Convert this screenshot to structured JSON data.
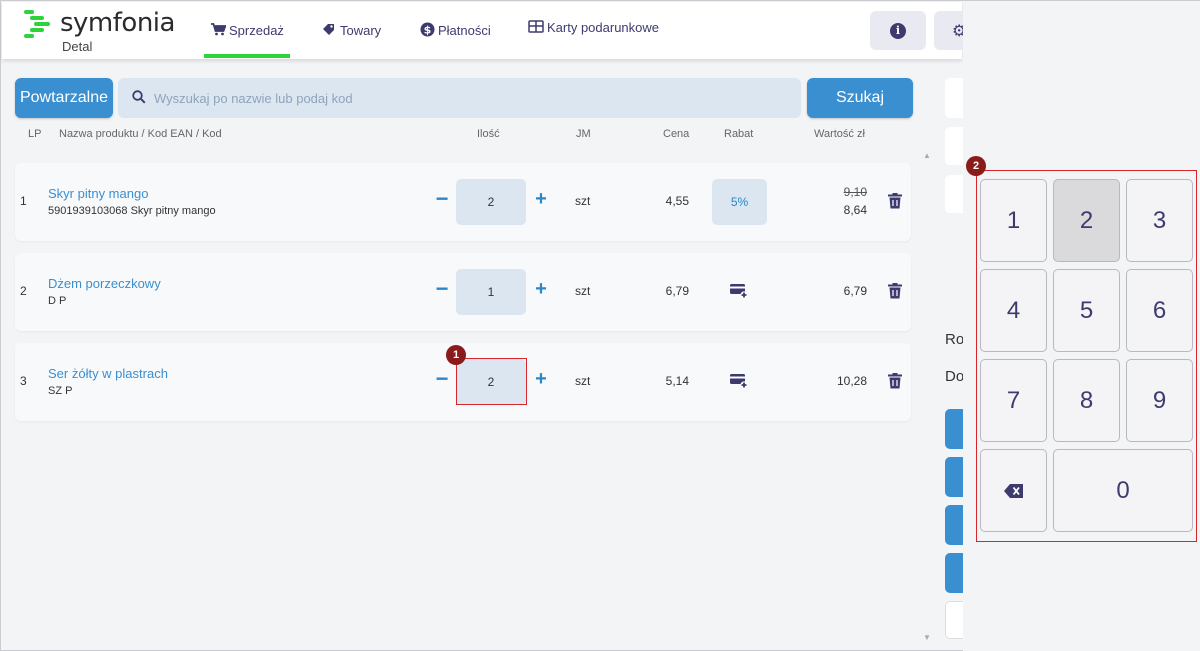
{
  "app": {
    "brand": "symfonia",
    "product": "Detal"
  },
  "nav": [
    {
      "label": "Sprzedaż",
      "icon": "cart-icon",
      "active": true
    },
    {
      "label": "Towary",
      "icon": "tag-icon"
    },
    {
      "label": "Płatności",
      "icon": "dollar-icon"
    },
    {
      "label": "Karty podarunkowe",
      "icon": "gift-card-icon"
    }
  ],
  "toolbar": {
    "repeatable_label": "Powtarzalne",
    "search_placeholder": "Wyszukaj po nazwie lub podaj kod",
    "search_button": "Szukaj"
  },
  "columns": {
    "lp": "LP",
    "name": "Nazwa produktu / Kod EAN / Kod",
    "qty": "Ilość",
    "unit": "JM",
    "price": "Cena",
    "discount": "Rabat",
    "value": "Wartość zł"
  },
  "rows": [
    {
      "lp": "1",
      "name": "Skyr pitny mango",
      "code": "5901939103068 Skyr pitny mango",
      "qty": "2",
      "unit": "szt",
      "price": "4,55",
      "discount": "5%",
      "value_old": "9,10",
      "value": "8,64"
    },
    {
      "lp": "2",
      "name": "Dżem porzeczkowy",
      "code": "D P",
      "qty": "1",
      "unit": "szt",
      "price": "6,79",
      "value": "6,79"
    },
    {
      "lp": "3",
      "name": "Ser żółty w plastrach",
      "code": "SZ P",
      "qty": "2",
      "unit": "szt",
      "price": "5,14",
      "value": "10,28"
    }
  ],
  "right_panel": {
    "label_a": "Ro",
    "label_b": "Do"
  },
  "keypad": {
    "keys": [
      "1",
      "2",
      "3",
      "4",
      "5",
      "6",
      "7",
      "8",
      "9",
      "0"
    ],
    "pressed": "2"
  },
  "annotations": {
    "badge_1": "1",
    "badge_2": "2"
  },
  "colors": {
    "accent": "#3a8fd0",
    "brand_green": "#2dd33b",
    "nav_text": "#3d3b6e",
    "highlight": "#d6262b"
  }
}
